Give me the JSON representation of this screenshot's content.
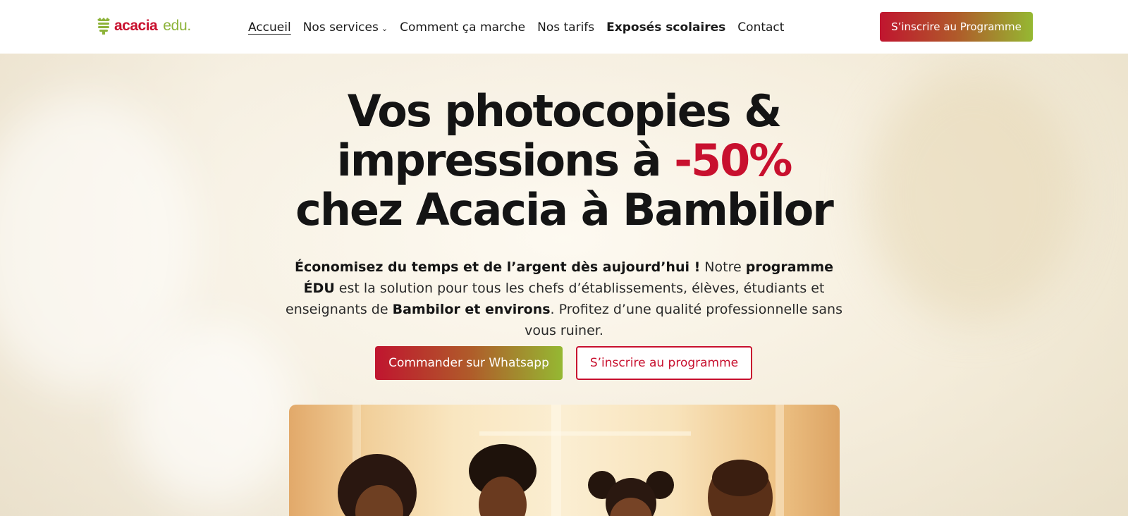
{
  "header": {
    "logo": {
      "brand": "acacia",
      "suffix": "edu."
    },
    "nav": [
      {
        "label": "Accueil",
        "active": true
      },
      {
        "label": "Nos services",
        "has_dropdown": true
      },
      {
        "label": "Comment ça marche"
      },
      {
        "label": "Nos tarifs"
      },
      {
        "label": "Exposés scolaires",
        "bold": true
      },
      {
        "label": "Contact"
      }
    ],
    "cta_label": "S’inscrire au Programme"
  },
  "hero": {
    "title_line1": "Vos photocopies &",
    "title_line2_prefix": "impressions à ",
    "title_line2_accent": "-50%",
    "title_line3": "chez Acacia à Bambilor",
    "subtitle": {
      "p1_bold": "Économisez du temps et de l’argent dès aujourd’hui !",
      "p2": " Notre ",
      "p3_bold": "programme ÉDU",
      "p4": " est la solution pour tous les chefs d’établissements, élèves, étudiants et enseignants de ",
      "p5_bold": "Bambilor et environs",
      "p6": ". Profitez d’une qualité professionnelle sans vous ruiner."
    },
    "primary_button": "Commander sur Whatsapp",
    "secondary_button": "S’inscrire au programme"
  },
  "colors": {
    "brand_red": "#c8102e",
    "brand_green": "#95b832",
    "text": "#141414"
  },
  "icons": [
    "logo-mark-icon",
    "chevron-down-icon"
  ]
}
